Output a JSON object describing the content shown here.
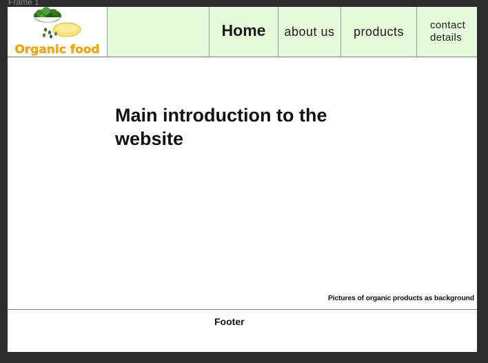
{
  "canvas": {
    "frame_label": "Frame 1"
  },
  "header": {
    "logo_text": "Organic food",
    "nav": {
      "home": "Home",
      "about": "about us",
      "products": "products",
      "contact_line1": "contact",
      "contact_line2": "details"
    }
  },
  "main": {
    "intro_line1": "Main introduction to the",
    "intro_line2": "website",
    "background_note": "Pictures of organic products as background"
  },
  "footer": {
    "label": "Footer"
  },
  "colors": {
    "nav_bg": "#e6fadb",
    "logo_text": "#f2a900",
    "page_bg": "#2c2c2c"
  }
}
